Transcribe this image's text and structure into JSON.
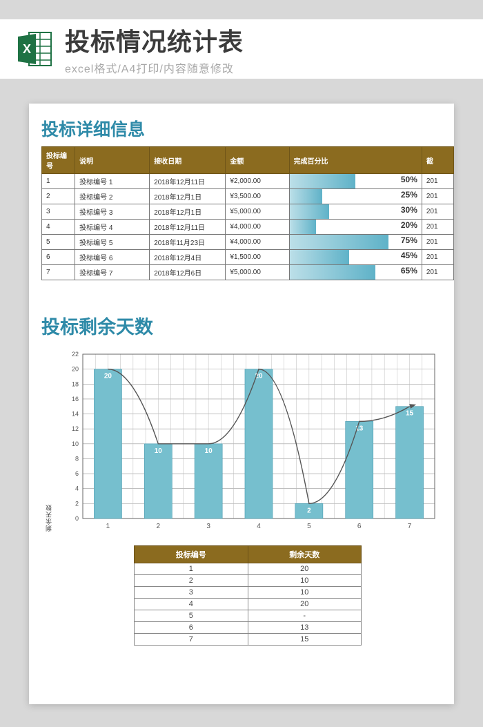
{
  "banner": {
    "title": "投标情况统计表",
    "subtitle": "excel格式/A4打印/内容随意修改"
  },
  "section_detail_title": "投标详细信息",
  "detail_headers": {
    "id": "投标编号",
    "desc": "说明",
    "date": "接收日期",
    "amount": "金额",
    "pct": "完成百分比",
    "cut": "截"
  },
  "detail_rows": [
    {
      "id": "1",
      "desc": "投标编号 1",
      "date": "2018年12月11日",
      "amount": "¥2,000.00",
      "pct": 50,
      "cut": "201"
    },
    {
      "id": "2",
      "desc": "投标编号 2",
      "date": "2018年12月1日",
      "amount": "¥3,500.00",
      "pct": 25,
      "cut": "201"
    },
    {
      "id": "3",
      "desc": "投标编号 3",
      "date": "2018年12月1日",
      "amount": "¥5,000.00",
      "pct": 30,
      "cut": "201"
    },
    {
      "id": "4",
      "desc": "投标编号 4",
      "date": "2018年12月11日",
      "amount": "¥4,000.00",
      "pct": 20,
      "cut": "201"
    },
    {
      "id": "5",
      "desc": "投标编号 5",
      "date": "2018年11月23日",
      "amount": "¥4,000.00",
      "pct": 75,
      "cut": "201"
    },
    {
      "id": "6",
      "desc": "投标编号 6",
      "date": "2018年12月4日",
      "amount": "¥1,500.00",
      "pct": 45,
      "cut": "201"
    },
    {
      "id": "7",
      "desc": "投标编号 7",
      "date": "2018年12月6日",
      "amount": "¥5,000.00",
      "pct": 65,
      "cut": "201"
    }
  ],
  "chart_section_title": "投标剩余天数",
  "chart_ylabel": "剩余天数",
  "chart_data": {
    "type": "bar",
    "title": "",
    "xlabel": "",
    "ylabel": "剩余天数",
    "ylim": [
      0,
      22
    ],
    "yticks": [
      0,
      2,
      4,
      6,
      8,
      10,
      12,
      14,
      16,
      18,
      20,
      22
    ],
    "categories": [
      "1",
      "2",
      "3",
      "4",
      "5",
      "6",
      "7"
    ],
    "values": [
      20,
      10,
      10,
      20,
      2,
      13,
      15
    ],
    "overlay_line": [
      20,
      10,
      10,
      20,
      2,
      13,
      15
    ]
  },
  "days_headers": {
    "id": "投标编号",
    "days": "剩余天数"
  },
  "days_rows": [
    {
      "id": "1",
      "days": "20"
    },
    {
      "id": "2",
      "days": "10"
    },
    {
      "id": "3",
      "days": "10"
    },
    {
      "id": "4",
      "days": "20"
    },
    {
      "id": "5",
      "days": "-"
    },
    {
      "id": "6",
      "days": "13"
    },
    {
      "id": "7",
      "days": "15"
    }
  ]
}
